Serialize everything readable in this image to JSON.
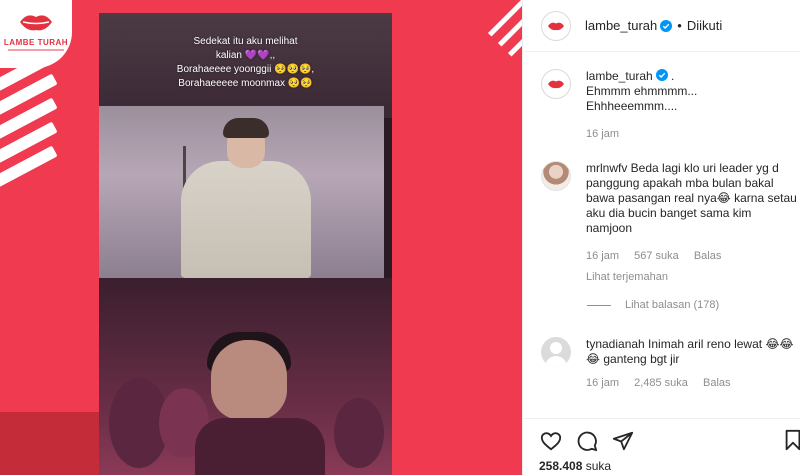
{
  "brand": {
    "name": "LAMBE TURAH"
  },
  "video": {
    "caption_lines": [
      "Sedekat itu aku melihat",
      "kalian 💜💜,,",
      "Borahaeeee yoonggii 🥺🥺🥺,",
      "Borahaeeeee moonmax 🥺🥺"
    ]
  },
  "header": {
    "username": "lambe_turah",
    "separator": "•",
    "follow_state": "Diikuti"
  },
  "post": {
    "username": "lambe_turah",
    "trailing": " .",
    "lines": [
      "Ehmmm ehmmmm...",
      "Ehhheeemmm...."
    ],
    "time": "16 jam"
  },
  "comments": [
    {
      "username": "mrlnwfv",
      "text": " Beda lagi klo uri leader yg d panggung apakah mba bulan bakal bawa pasangan real nya😂 karna setau aku dia bucin banget sama kim namjoon",
      "time": "16 jam",
      "likes": "567 suka",
      "reply": "Balas",
      "translate": "Lihat terjemahan",
      "view_replies": "Lihat balasan (178)"
    },
    {
      "username": "tynadianah",
      "text": " Inimah aril reno lewat 😂😂😂 ganteng bgt jir",
      "time": "16 jam",
      "likes": "2,485 suka",
      "reply": "Balas"
    }
  ],
  "footer": {
    "likes_count": "258.408",
    "likes_label": " suka"
  },
  "colors": {
    "brand_red": "#ef3a50",
    "verified_blue": "#0095f6",
    "muted_text": "#8e8e8e"
  },
  "icons": {
    "like": "heart-icon",
    "comment": "comment-bubble-icon",
    "share": "paper-plane-icon",
    "save": "bookmark-icon"
  }
}
